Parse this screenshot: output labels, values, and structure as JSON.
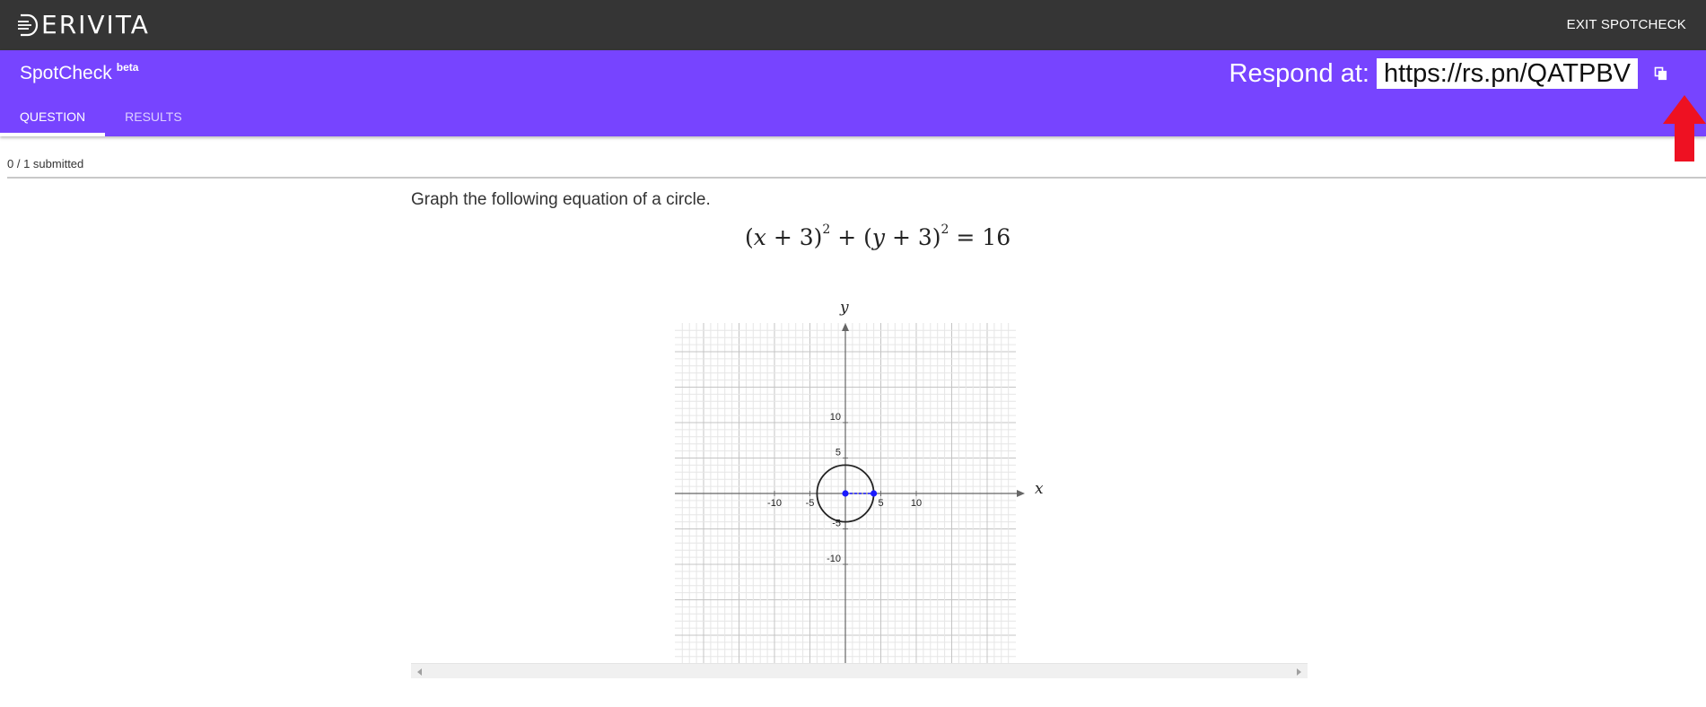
{
  "topbar": {
    "logo_text": "ERIVITA",
    "exit_label": "EXIT SPOTCHECK"
  },
  "header": {
    "title": "SpotCheck",
    "badge": "beta",
    "respond_label": "Respond at:",
    "respond_url": "https://rs.pn/QATPBV",
    "accent_color": "#7744ff"
  },
  "tabs": [
    {
      "label": "QUESTION",
      "active": true
    },
    {
      "label": "RESULTS",
      "active": false
    }
  ],
  "status": {
    "submitted_text": "0 / 1 submitted"
  },
  "question": {
    "prompt": "Graph the following equation of a circle.",
    "equation": {
      "lhs_open": "(",
      "x": "x",
      "plus3a": " + 3)",
      "exp": "2",
      "plus": " + (",
      "y": "y",
      "plus3b": " + 3)",
      "equals": " = 16"
    }
  },
  "graph": {
    "x_axis_name": "x",
    "y_axis_name": "y",
    "x_range": [
      -12,
      12
    ],
    "y_range": [
      -12,
      12
    ],
    "x_tick_labels": [
      "-10",
      "-5",
      "5",
      "10"
    ],
    "x_tick_values": [
      -10,
      -5,
      5,
      10
    ],
    "y_tick_labels": [
      "10",
      "5",
      "-5",
      "-10"
    ],
    "y_tick_values": [
      10,
      5,
      -5,
      -10
    ],
    "circle": {
      "center": [
        0,
        0
      ],
      "radius": 4
    },
    "points": [
      {
        "name": "center-point",
        "x": 0,
        "y": 0
      },
      {
        "name": "radius-point",
        "x": 4,
        "y": 0
      }
    ],
    "point_color": "#1a1aff"
  },
  "annotation": {
    "arrow_color": "#ee1122",
    "icon": "up-arrow-icon"
  }
}
